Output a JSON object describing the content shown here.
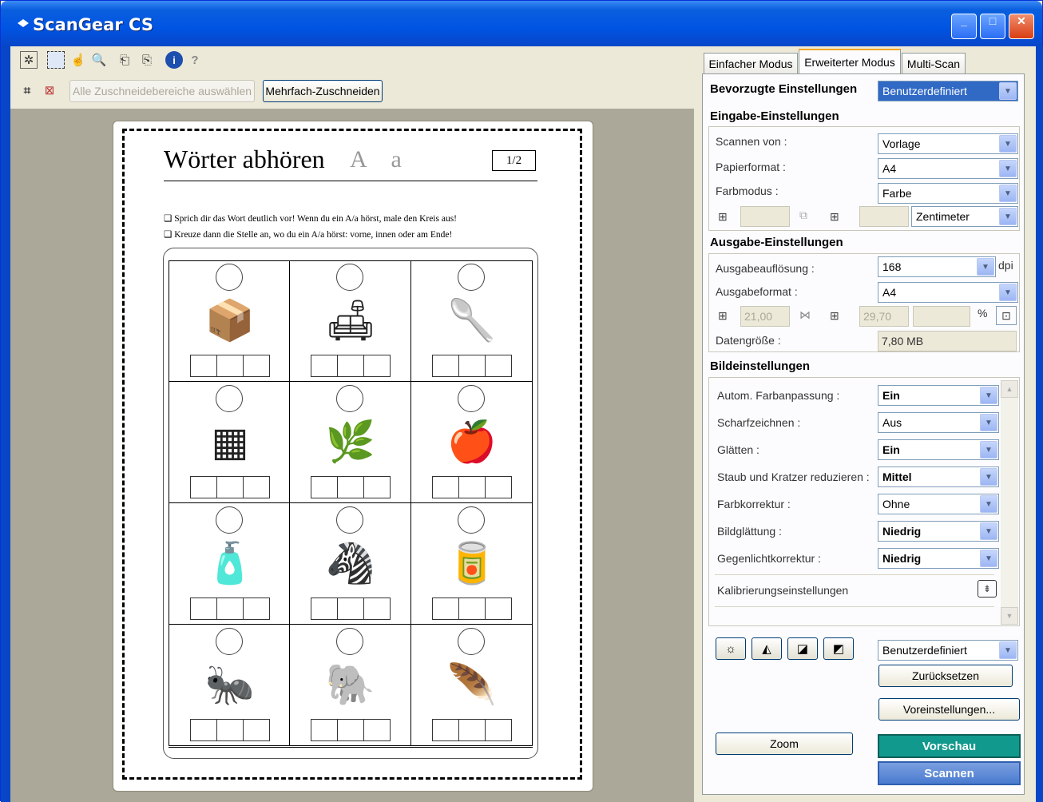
{
  "window": {
    "title": "ScanGear CS",
    "controls": {
      "minimize": "_",
      "maximize": "□",
      "close": "✕"
    }
  },
  "toolbar": {
    "icons": [
      "auto-crop-icon",
      "select-crop-icon",
      "hand-icon",
      "magnifier-icon",
      "rotate-left-icon",
      "rotate-right-icon",
      "info-icon",
      "help-icon"
    ],
    "select_all_label": "Alle Zuschneidebereiche auswählen",
    "multi_crop_label": "Mehrfach-Zuschneiden"
  },
  "document": {
    "title": "Wörter abhören",
    "letters": "A a",
    "page": "1/2",
    "instruction1": "Sprich dir das Wort deutlich vor! Wenn du ein A/a hörst, male den Kreis aus!",
    "instruction2": "Kreuze dann die Stelle an, wo du ein A/a hörst: vorne, innen oder am Ende!",
    "pictures": [
      "📦",
      "🛋",
      "🥄",
      "▦",
      "🌿",
      "🍎",
      "🧴",
      "🦓",
      "🥫",
      "🐜",
      "🐘",
      "🪶"
    ]
  },
  "tabs": {
    "simple": "Einfacher Modus",
    "advanced": "Erweiterter Modus",
    "multiscan": "Multi-Scan"
  },
  "preferred": {
    "label": "Bevorzugte Einstellungen",
    "value": "Benutzerdefiniert"
  },
  "input": {
    "heading": "Eingabe-Einstellungen",
    "scan_from_label": "Scannen von :",
    "scan_from": "Vorlage",
    "paper_label": "Papierformat :",
    "paper": "A4",
    "color_label": "Farbmodus :",
    "color": "Farbe",
    "unit": "Zentimeter"
  },
  "output": {
    "heading": "Ausgabe-Einstellungen",
    "resolution_label": "Ausgabeauflösung :",
    "resolution": "168",
    "dpi": "dpi",
    "format_label": "Ausgabeformat :",
    "format": "A4",
    "width": "21,00",
    "height": "29,70",
    "percent": "%",
    "size_label": "Datengröße :",
    "size": "7,80 MB"
  },
  "image": {
    "heading": "Bildeinstellungen",
    "rows": [
      {
        "label": "Autom. Farbanpassung :",
        "value": "Ein"
      },
      {
        "label": "Scharfzeichnen :",
        "value": "Aus"
      },
      {
        "label": "Glätten :",
        "value": "Ein"
      },
      {
        "label": "Staub und Kratzer reduzieren :",
        "value": "Mittel"
      },
      {
        "label": "Farbkorrektur :",
        "value": "Ohne"
      },
      {
        "label": "Bildglättung :",
        "value": "Niedrig"
      },
      {
        "label": "Gegenlichtkorrektur :",
        "value": "Niedrig"
      }
    ],
    "calibration_label": "Kalibrierungseinstellungen"
  },
  "bottom": {
    "preset": "Benutzerdefiniert",
    "reset": "Zurücksetzen",
    "preferences": "Voreinstellungen...",
    "zoom": "Zoom",
    "preview": "Vorschau",
    "scan": "Scannen"
  }
}
